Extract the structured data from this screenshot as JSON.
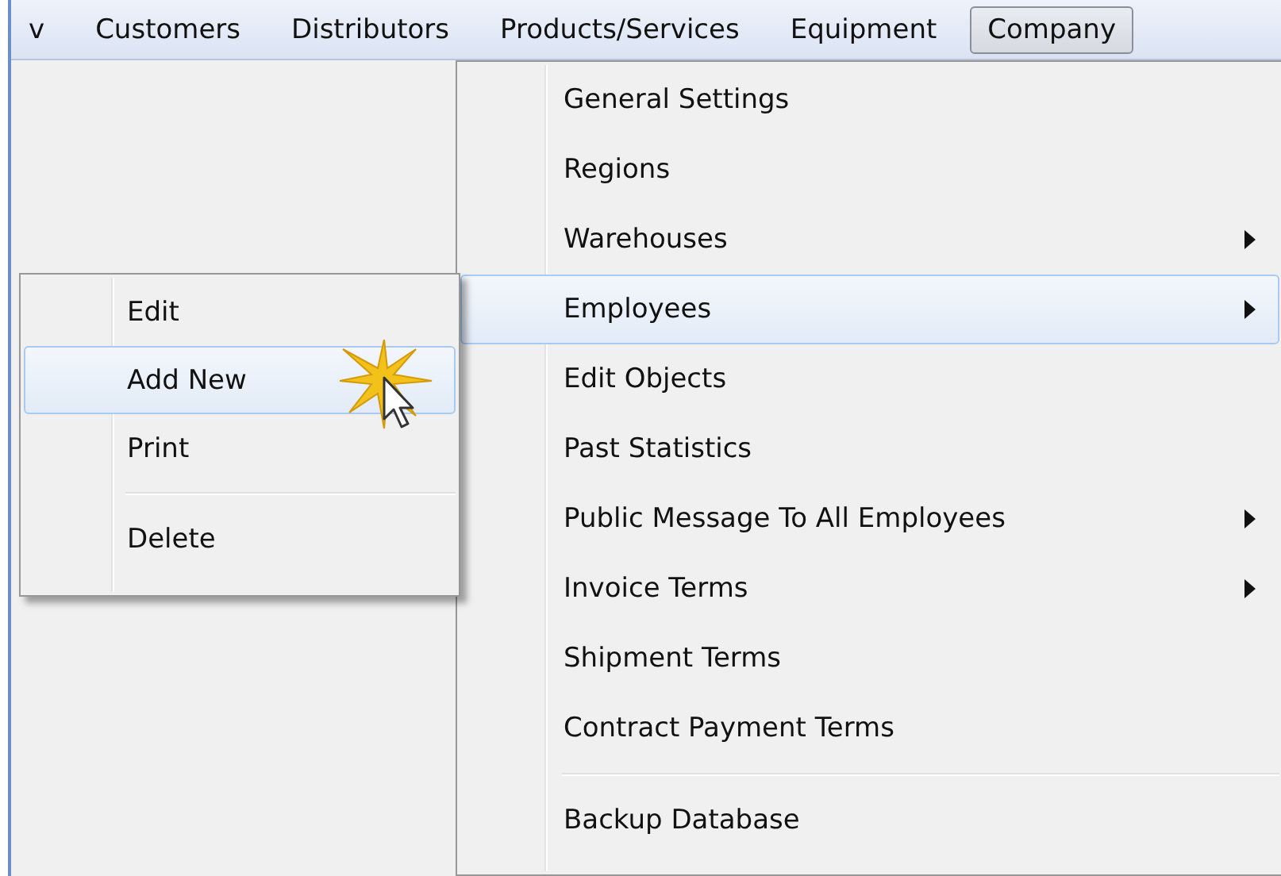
{
  "menubar": [
    {
      "label": "v",
      "selected": false
    },
    {
      "label": "Customers",
      "selected": false
    },
    {
      "label": "Distributors",
      "selected": false
    },
    {
      "label": "Products/Services",
      "selected": false
    },
    {
      "label": "Equipment",
      "selected": false
    },
    {
      "label": "Company",
      "selected": true
    }
  ],
  "company_menu": [
    {
      "kind": "item",
      "label": "General Settings",
      "selected": false,
      "submenu": false
    },
    {
      "kind": "item",
      "label": "Regions",
      "selected": false,
      "submenu": false
    },
    {
      "kind": "item",
      "label": "Warehouses",
      "selected": false,
      "submenu": true
    },
    {
      "kind": "item",
      "label": "Employees",
      "selected": true,
      "submenu": true
    },
    {
      "kind": "item",
      "label": "Edit Objects",
      "selected": false,
      "submenu": false
    },
    {
      "kind": "item",
      "label": "Past Statistics",
      "selected": false,
      "submenu": false
    },
    {
      "kind": "item",
      "label": "Public Message To All Employees",
      "selected": false,
      "submenu": true
    },
    {
      "kind": "item",
      "label": "Invoice Terms",
      "selected": false,
      "submenu": true
    },
    {
      "kind": "item",
      "label": "Shipment Terms",
      "selected": false,
      "submenu": false
    },
    {
      "kind": "item",
      "label": "Contract Payment Terms",
      "selected": false,
      "submenu": false
    },
    {
      "kind": "separator"
    },
    {
      "kind": "item",
      "label": "Backup Database",
      "selected": false,
      "submenu": false
    }
  ],
  "employees_submenu": [
    {
      "kind": "item",
      "label": "Edit",
      "selected": false
    },
    {
      "kind": "item",
      "label": "Add New",
      "selected": true
    },
    {
      "kind": "item",
      "label": "Print",
      "selected": false
    },
    {
      "kind": "separator"
    },
    {
      "kind": "item",
      "label": "Delete",
      "selected": false
    }
  ]
}
